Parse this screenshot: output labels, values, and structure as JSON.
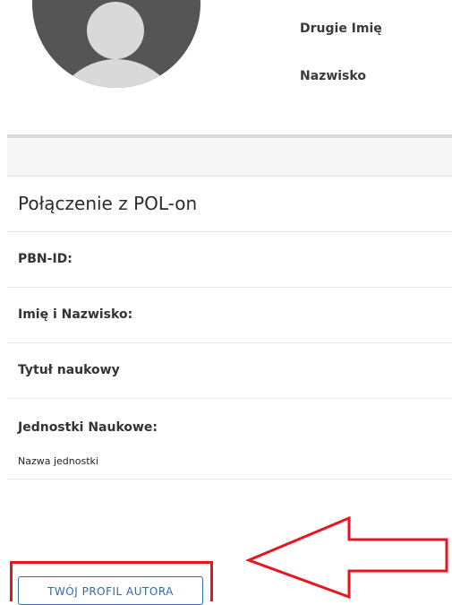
{
  "profile": {
    "middle_name_label": "Drugie Imię",
    "surname_label": "Nazwisko"
  },
  "polon_section": {
    "title": "Połączenie z POL-on",
    "fields": [
      {
        "label": "PBN-ID:"
      },
      {
        "label": "Imię i Nazwisko:"
      },
      {
        "label": "Tytuł naukowy"
      }
    ],
    "units_label": "Jednostki Naukowe:",
    "unit_name": "Nazwa jednostki"
  },
  "author_profile_button": "TWÓJ PROFIL AUTORA",
  "annotation": {
    "color": "#e8141f",
    "arrow_direction": "left"
  },
  "colors": {
    "button_blue": "#2f6bb0",
    "avatar_dark": "#555555",
    "avatar_light": "#d9d9d9"
  }
}
